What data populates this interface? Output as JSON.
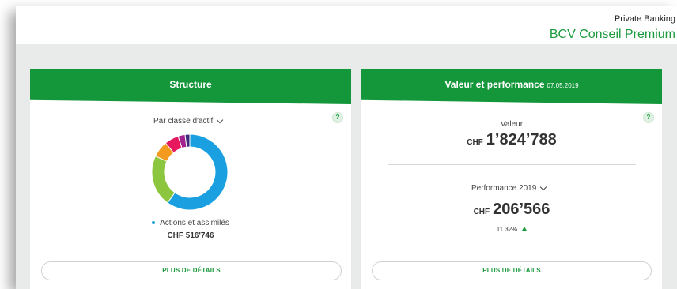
{
  "brand": {
    "small": "Private Banking",
    "big": "BCV Conseil Premium"
  },
  "structure_card": {
    "title": "Structure",
    "help_label": "?",
    "selector_label": "Par classe d'actif",
    "legend_label": "Actions et assimilés",
    "legend_amount": "CHF 516'746",
    "details_button": "PLUS DE DÉTAILS",
    "colors": {
      "header": "#14963a",
      "primary_slice": "#1aa0e0"
    },
    "donut_segments": [
      {
        "color": "#1aa0e0",
        "fraction": 0.6
      },
      {
        "color": "#8cc63f",
        "fraction": 0.22
      },
      {
        "color": "#f39a21",
        "fraction": 0.07
      },
      {
        "color": "#e6195e",
        "fraction": 0.06
      },
      {
        "color": "#a3238e",
        "fraction": 0.03
      },
      {
        "color": "#3c2a7a",
        "fraction": 0.02
      }
    ]
  },
  "value_card": {
    "title": "Valeur et performance",
    "title_date": "07.05.2019",
    "help_label": "?",
    "value_label": "Valeur",
    "value_currency": "CHF",
    "value_amount": "1’824’788",
    "perf_selector_label": "Performance 2019",
    "perf_currency": "CHF",
    "perf_amount": "206’566",
    "perf_percent": "11.32%",
    "details_button": "PLUS DE DÉTAILS"
  }
}
